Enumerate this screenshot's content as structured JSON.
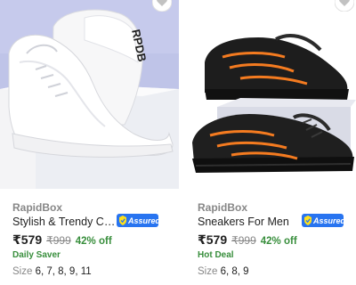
{
  "products": [
    {
      "brand": "RapidBox",
      "title": "Stylish & Trendy Casuals...",
      "price": "₹579",
      "mrp": "₹999",
      "discount": "42% off",
      "deal": "Daily Saver",
      "size_label": "Size",
      "sizes": "6, 7, 8, 9, 11",
      "shoe_text": "RPDB",
      "assured_label": "Assured"
    },
    {
      "brand": "RapidBox",
      "title": "Sneakers For Men",
      "price": "₹579",
      "mrp": "₹999",
      "discount": "42% off",
      "deal": "Hot Deal",
      "size_label": "Size",
      "sizes": "6, 8, 9",
      "assured_label": "Assured"
    }
  ],
  "colors": {
    "assured_blue": "#2874f0",
    "discount_green": "#388e3c",
    "muted_gray": "#878787",
    "sneaker_accent": "#f47b20"
  },
  "icons": [
    "heart-icon",
    "assured-badge-icon"
  ]
}
